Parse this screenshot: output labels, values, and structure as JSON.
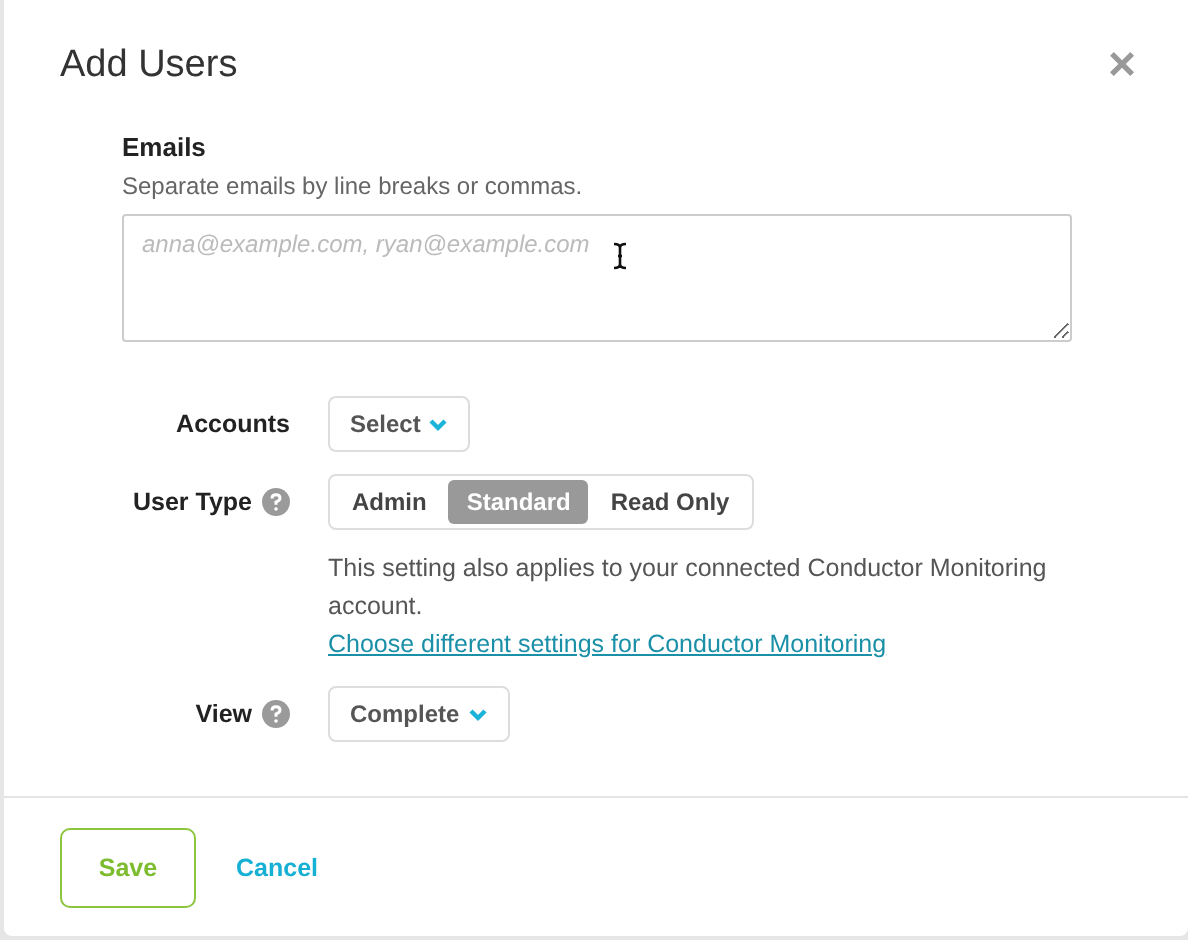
{
  "dialog": {
    "title": "Add Users",
    "close": "×"
  },
  "emails": {
    "label": "Emails",
    "hint": "Separate emails by line breaks or commas.",
    "placeholder": "anna@example.com, ryan@example.com"
  },
  "accounts": {
    "label": "Accounts",
    "value": "Select"
  },
  "user_type": {
    "label": "User Type",
    "help": true,
    "options": [
      {
        "label": "Admin",
        "selected": false
      },
      {
        "label": "Standard",
        "selected": true
      },
      {
        "label": "Read Only",
        "selected": false
      }
    ],
    "note": "This setting also applies to your connected Conductor Monitoring account.",
    "link": "Choose different settings for Conductor Monitoring"
  },
  "view": {
    "label": "View",
    "help": true,
    "value": "Complete"
  },
  "buttons": [
    {
      "label": "Save",
      "kind": "primary"
    },
    {
      "label": "Cancel",
      "kind": "link"
    }
  ]
}
